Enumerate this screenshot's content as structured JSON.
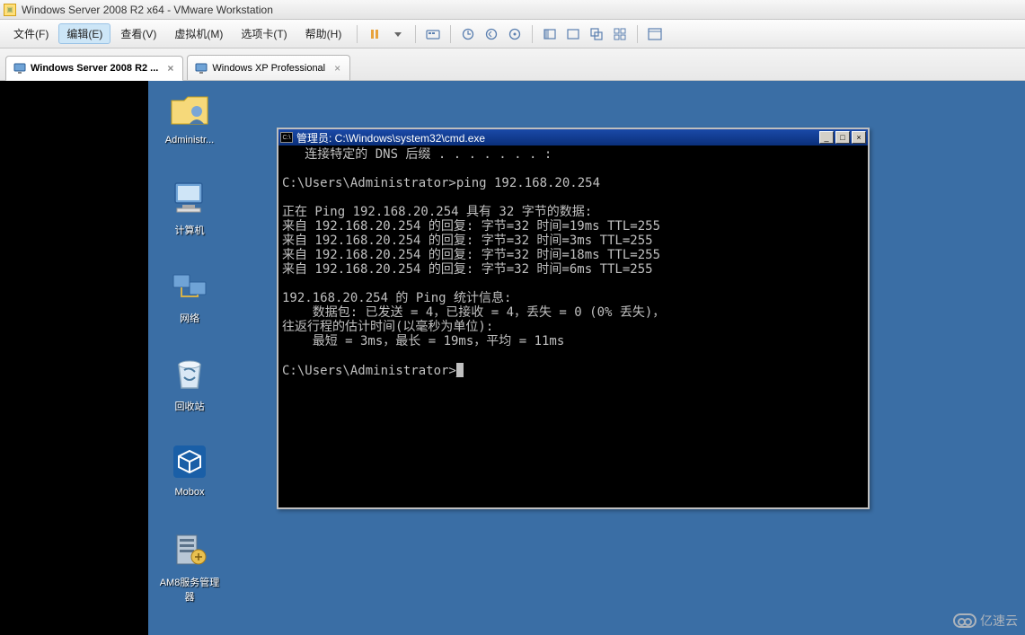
{
  "window": {
    "title": "Windows Server 2008 R2 x64 - VMware Workstation"
  },
  "menu": {
    "file": "文件(F)",
    "edit": "编辑(E)",
    "view": "查看(V)",
    "vm": "虚拟机(M)",
    "tabs": "选项卡(T)",
    "help": "帮助(H)"
  },
  "tabs": [
    {
      "label": "Windows Server 2008 R2 ...",
      "active": true
    },
    {
      "label": "Windows XP Professional",
      "active": false
    }
  ],
  "desktop_icons": {
    "admin": "Administr...",
    "computer": "计算机",
    "network": "网络",
    "recycle": "回收站",
    "mobox": "Mobox",
    "am8": "AM8服务管理器"
  },
  "cmd": {
    "title": "管理员: C:\\Windows\\system32\\cmd.exe",
    "lines": [
      "   连接特定的 DNS 后缀 . . . . . . . :",
      "",
      "C:\\Users\\Administrator>ping 192.168.20.254",
      "",
      "正在 Ping 192.168.20.254 具有 32 字节的数据:",
      "来自 192.168.20.254 的回复: 字节=32 时间=19ms TTL=255",
      "来自 192.168.20.254 的回复: 字节=32 时间=3ms TTL=255",
      "来自 192.168.20.254 的回复: 字节=32 时间=18ms TTL=255",
      "来自 192.168.20.254 的回复: 字节=32 时间=6ms TTL=255",
      "",
      "192.168.20.254 的 Ping 统计信息:",
      "    数据包: 已发送 = 4，已接收 = 4，丢失 = 0 (0% 丢失)，",
      "往返行程的估计时间(以毫秒为单位):",
      "    最短 = 3ms，最长 = 19ms，平均 = 11ms",
      "",
      "C:\\Users\\Administrator>"
    ]
  },
  "watermark": "亿速云"
}
